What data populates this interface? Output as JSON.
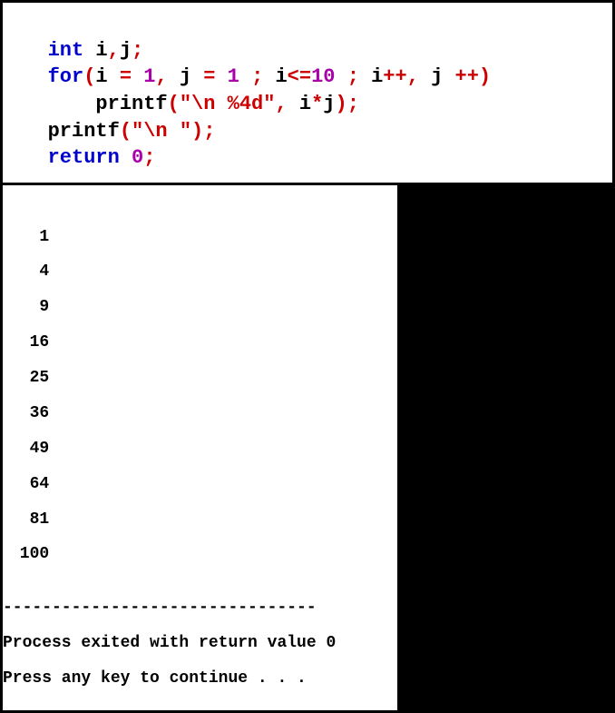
{
  "code": {
    "indent1": "   ",
    "indent2": "       ",
    "kw_int": "int",
    "decl_ids": " i",
    "comma": ",",
    "decl_j": "j",
    "semi": ";",
    "kw_for": "for",
    "lparen": "(",
    "rparen": ")",
    "i": "i",
    "j": "j",
    "sp": " ",
    "eq": "=",
    "one": "1",
    "le": "<=",
    "ten": "10",
    "pp": "++",
    "star": "*",
    "printf": "printf",
    "str_fmt": "\"\\n %4d\"",
    "str_nl": "\"\\n \"",
    "kw_return": "return",
    "zero": "0"
  },
  "console": {
    "outputs": [
      "   1",
      "   4",
      "   9",
      "  16",
      "  25",
      "  36",
      "  49",
      "  64",
      "  81",
      " 100"
    ],
    "blank": "",
    "sep": "--------------------------------",
    "msg1": "Process exited with return value 0",
    "msg2": "Press any key to continue . . ."
  }
}
